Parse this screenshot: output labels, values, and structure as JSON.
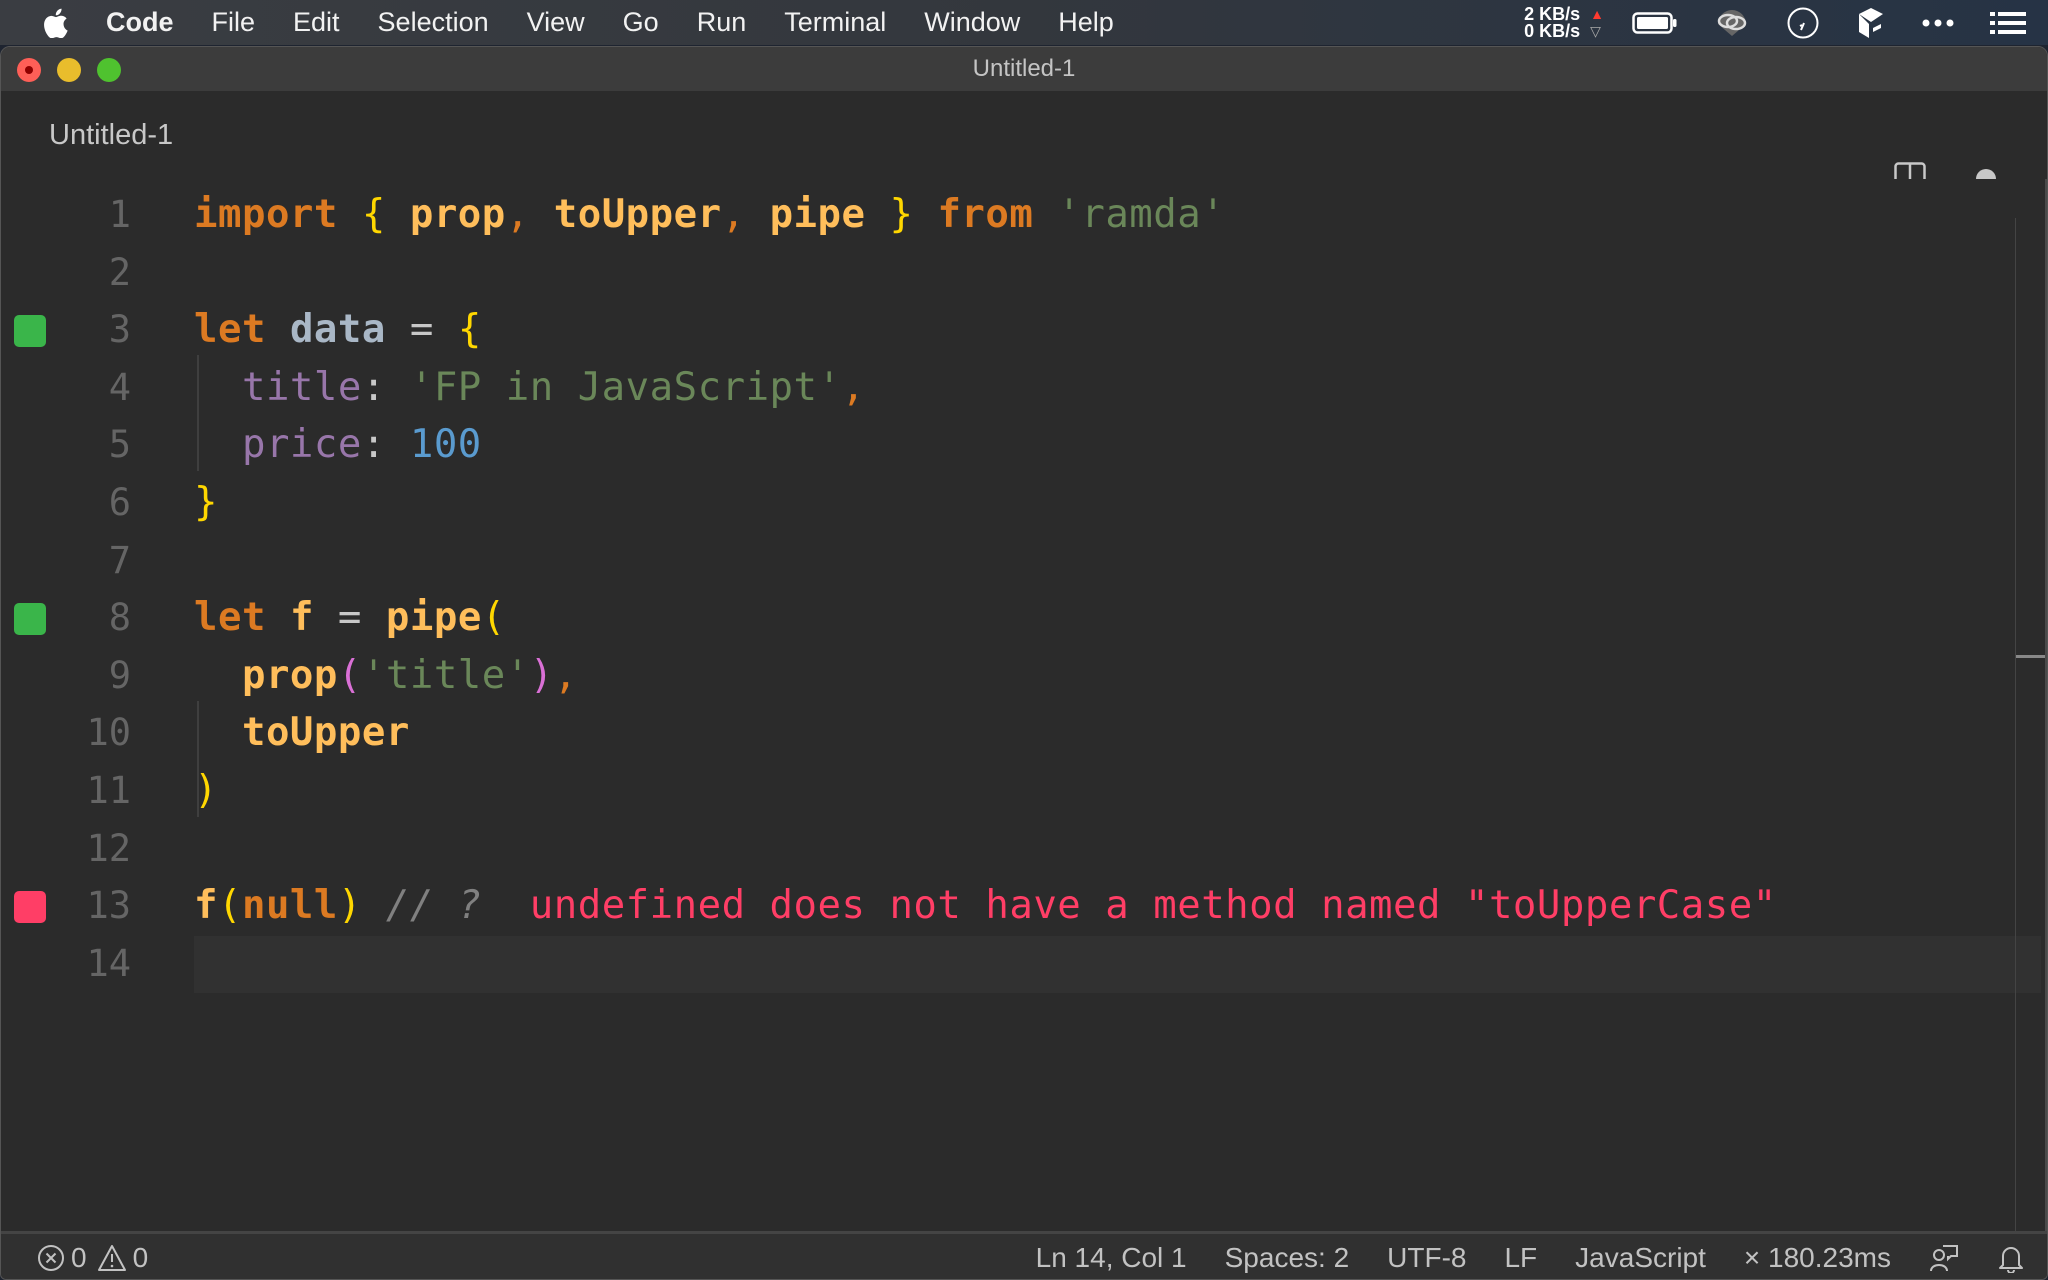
{
  "menubar": {
    "apple_icon": "apple-logo-icon",
    "items": [
      "Code",
      "File",
      "Edit",
      "Selection",
      "View",
      "Go",
      "Run",
      "Terminal",
      "Window",
      "Help"
    ],
    "network": {
      "up": "2 KB/s",
      "down": "0 KB/s"
    },
    "tray_icons": [
      "battery-icon",
      "creative-cloud-icon",
      "clock-icon",
      "dropbox-icon",
      "more-icon",
      "notification-list-icon"
    ]
  },
  "window": {
    "title": "Untitled-1"
  },
  "tab": {
    "label": "Untitled-1",
    "split_icon": "split-editor-icon",
    "dirty_indicator": "unsaved-dot-icon"
  },
  "editor": {
    "current_line": 14,
    "lines": [
      {
        "n": "1",
        "marker": "",
        "tokens": [
          {
            "t": "import",
            "c": "kw"
          },
          {
            "t": " ",
            "c": "op"
          },
          {
            "t": "{",
            "c": "brace"
          },
          {
            "t": " ",
            "c": "op"
          },
          {
            "t": "prop",
            "c": "fn"
          },
          {
            "t": ",",
            "c": "punct"
          },
          {
            "t": " ",
            "c": "op"
          },
          {
            "t": "toUpper",
            "c": "fn"
          },
          {
            "t": ",",
            "c": "punct"
          },
          {
            "t": " ",
            "c": "op"
          },
          {
            "t": "pipe",
            "c": "fn"
          },
          {
            "t": " ",
            "c": "op"
          },
          {
            "t": "}",
            "c": "brace"
          },
          {
            "t": " ",
            "c": "op"
          },
          {
            "t": "from",
            "c": "kw"
          },
          {
            "t": " ",
            "c": "op"
          },
          {
            "t": "'ramda'",
            "c": "str"
          }
        ]
      },
      {
        "n": "2",
        "marker": "",
        "tokens": []
      },
      {
        "n": "3",
        "marker": "ok",
        "tokens": [
          {
            "t": "let",
            "c": "kw"
          },
          {
            "t": " ",
            "c": "op"
          },
          {
            "t": "data",
            "c": "var"
          },
          {
            "t": " = ",
            "c": "op"
          },
          {
            "t": "{",
            "c": "brace"
          }
        ]
      },
      {
        "n": "4",
        "marker": "",
        "tokens": [
          {
            "t": "  ",
            "c": "op"
          },
          {
            "t": "title",
            "c": "prop"
          },
          {
            "t": ": ",
            "c": "op"
          },
          {
            "t": "'FP in JavaScript'",
            "c": "str"
          },
          {
            "t": ",",
            "c": "punct"
          }
        ]
      },
      {
        "n": "5",
        "marker": "",
        "tokens": [
          {
            "t": "  ",
            "c": "op"
          },
          {
            "t": "price",
            "c": "prop"
          },
          {
            "t": ": ",
            "c": "op"
          },
          {
            "t": "100",
            "c": "num"
          }
        ]
      },
      {
        "n": "6",
        "marker": "",
        "tokens": [
          {
            "t": "}",
            "c": "brace"
          }
        ]
      },
      {
        "n": "7",
        "marker": "",
        "tokens": []
      },
      {
        "n": "8",
        "marker": "ok",
        "tokens": [
          {
            "t": "let",
            "c": "kw"
          },
          {
            "t": " ",
            "c": "op"
          },
          {
            "t": "f",
            "c": "fn"
          },
          {
            "t": " = ",
            "c": "op"
          },
          {
            "t": "pipe",
            "c": "fn"
          },
          {
            "t": "(",
            "c": "brace"
          }
        ]
      },
      {
        "n": "9",
        "marker": "",
        "tokens": [
          {
            "t": "  ",
            "c": "op"
          },
          {
            "t": "prop",
            "c": "fn"
          },
          {
            "t": "(",
            "c": "paren2"
          },
          {
            "t": "'title'",
            "c": "str"
          },
          {
            "t": ")",
            "c": "paren2"
          },
          {
            "t": ",",
            "c": "punct"
          }
        ]
      },
      {
        "n": "10",
        "marker": "",
        "tokens": [
          {
            "t": "  ",
            "c": "op"
          },
          {
            "t": "toUpper",
            "c": "fn"
          }
        ]
      },
      {
        "n": "11",
        "marker": "",
        "tokens": [
          {
            "t": ")",
            "c": "brace"
          }
        ]
      },
      {
        "n": "12",
        "marker": "",
        "tokens": []
      },
      {
        "n": "13",
        "marker": "err",
        "tokens": [
          {
            "t": "f",
            "c": "fn"
          },
          {
            "t": "(",
            "c": "brace"
          },
          {
            "t": "null",
            "c": "null"
          },
          {
            "t": ")",
            "c": "brace"
          },
          {
            "t": " ",
            "c": "op"
          },
          {
            "t": "// ?",
            "c": "comment"
          },
          {
            "t": "  ",
            "c": "op"
          },
          {
            "t": "undefined does not have a method named \"toUpperCase\"",
            "c": "err-msg"
          }
        ]
      },
      {
        "n": "14",
        "marker": "",
        "tokens": []
      }
    ]
  },
  "statusbar": {
    "errors": "0",
    "warnings": "0",
    "position": "Ln 14, Col 1",
    "indentation": "Spaces: 2",
    "encoding": "UTF-8",
    "eol": "LF",
    "language": "JavaScript",
    "quokka_timing": "× 180.23ms"
  }
}
